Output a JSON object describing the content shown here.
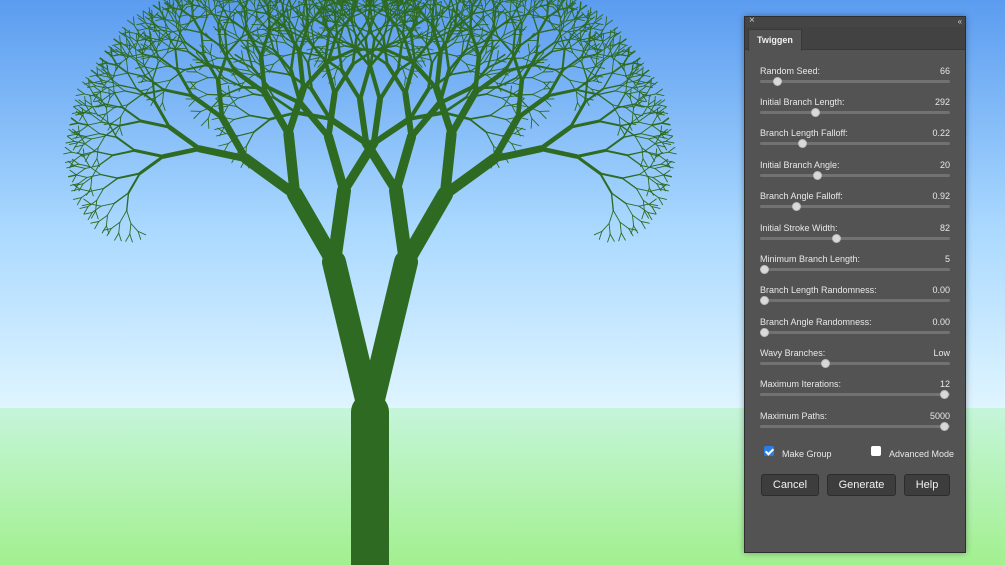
{
  "panel": {
    "close_glyph": "×",
    "collapse_glyph": "‹‹",
    "tab_label": "Twiggen",
    "sliders": [
      {
        "label": "Random Seed:",
        "value": "66",
        "position": 0.09
      },
      {
        "label": "Initial Branch Length:",
        "value": "292",
        "position": 0.29
      },
      {
        "label": "Branch Length Falloff:",
        "value": "0.22",
        "position": 0.22
      },
      {
        "label": "Initial Branch Angle:",
        "value": "20",
        "position": 0.3
      },
      {
        "label": "Branch Angle Falloff:",
        "value": "0.92",
        "position": 0.19
      },
      {
        "label": "Initial Stroke Width:",
        "value": "82",
        "position": 0.4
      },
      {
        "label": "Minimum Branch Length:",
        "value": "5",
        "position": 0.02
      },
      {
        "label": "Branch Length Randomness:",
        "value": "0.00",
        "position": 0.02
      },
      {
        "label": "Branch Angle Randomness:",
        "value": "0.00",
        "position": 0.02
      },
      {
        "label": "Wavy Branches:",
        "value": "Low",
        "position": 0.34
      },
      {
        "label": "Maximum Iterations:",
        "value": "12",
        "position": 0.97
      },
      {
        "label": "Maximum Paths:",
        "value": "5000",
        "position": 0.97
      }
    ],
    "make_group": {
      "label": "Make Group",
      "checked": true
    },
    "advanced_mode": {
      "label": "Advanced Mode",
      "checked": false
    },
    "buttons": {
      "cancel": "Cancel",
      "generate": "Generate",
      "help": "Help"
    }
  },
  "colors": {
    "tree": "#2e6a21",
    "sky_top": "#5b9cf0",
    "sky_bottom": "#dff5ff",
    "ground_top": "#c5f5da",
    "ground_bottom": "#a2f08f",
    "panel_bg": "#535353",
    "accent": "#2a7ce6"
  }
}
